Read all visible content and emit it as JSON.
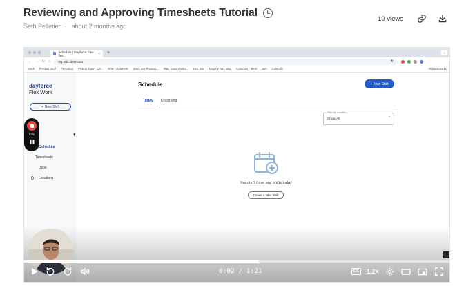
{
  "header": {
    "title": "Reviewing and Approving Timesheets Tutorial",
    "author": "Seth Pelletier",
    "separator": "·",
    "time_ago": "about 2 months ago",
    "views": "10 views",
    "icons": [
      "clock-icon",
      "link-icon",
      "download-icon"
    ]
  },
  "browser": {
    "tab_title": "Schedule | Dayforce Flex Wo...",
    "tab_close": "×",
    "new_tab": "+",
    "url": "stg.wiki.ideal.com",
    "bookmarks": [
      "Work",
      "Product Stuff",
      "Reporting",
      "Project Tutor - Ca...",
      "Now - Rules etc",
      "Work any Product...",
      "Man Trade Works...",
      "Dev Site",
      "Employ Nav Map",
      "Schedule | Ideal",
      "Jam",
      "Calendly"
    ],
    "all_bookmarks": "All Bookmarks"
  },
  "app": {
    "brand_line1": "dayforce",
    "brand_line2": "Flex Work",
    "side_new_shift": "New Shift",
    "nav": {
      "schedule": "Schedule",
      "timesheets": "Timesheets",
      "jobs": "Jobs",
      "locations": "Locations"
    },
    "recorder": {
      "time": "0:01",
      "pause": "❚❚"
    },
    "page_title": "Schedule",
    "new_shift_button": "New Shift",
    "tabs": {
      "today": "Today",
      "upcoming": "Upcoming"
    },
    "filter": {
      "label": "Filter by Location",
      "value": "Show All",
      "arrow": "⌃"
    },
    "empty_text": "You don't have any shifts today",
    "create_button": "Create a New Shift"
  },
  "player": {
    "current_time": "0:02",
    "duration": "1:21",
    "time_display": "0:02 / 1:21",
    "speed": "1.2×",
    "cc": "CC",
    "progress_fraction": 0.55
  },
  "colors": {
    "accent": "#1f5cc9",
    "brand": "#1f3a8a",
    "record_red": "#e8453c"
  }
}
